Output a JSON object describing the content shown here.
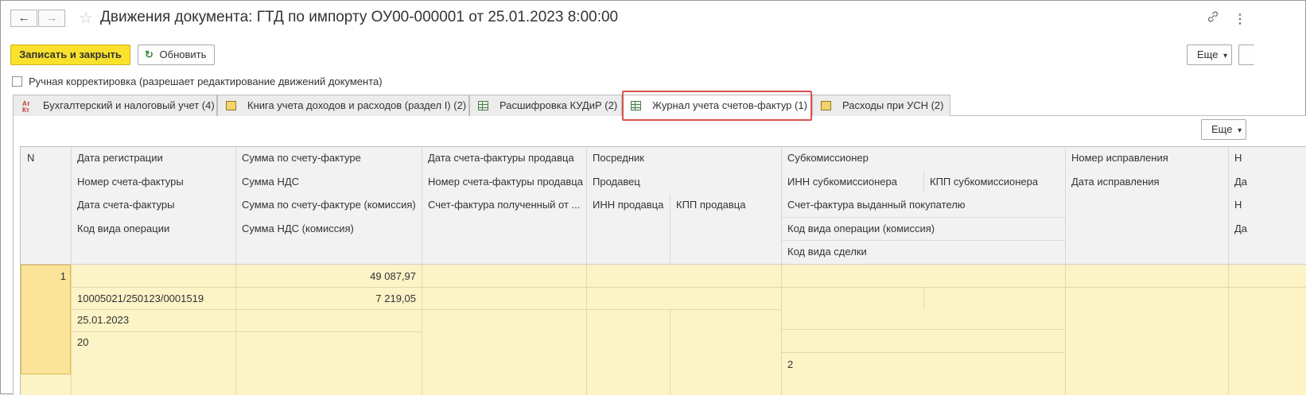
{
  "window": {
    "title": "Движения документа: ГТД по импорту ОУ00-000001 от 25.01.2023 8:00:00",
    "back_icon": "←",
    "forward_icon": "→",
    "favorite_icon": "☆",
    "link_icon": "🔗",
    "more_icon": "⋮"
  },
  "toolbar": {
    "save_close_label": "Записать и закрыть",
    "refresh_label": "Обновить",
    "refresh_icon": "↻",
    "more_label": "Еще",
    "dropdown_icon": "▾"
  },
  "manual_edit": {
    "checked": false,
    "label": "Ручная корректировка (разрешает редактирование движений документа)"
  },
  "tabs": [
    {
      "label": "Бухгалтерский и налоговый учет (4)",
      "icon": "atkt-icon",
      "icon_text": "Ат\nКт"
    },
    {
      "label": "Книга учета доходов и расходов (раздел I) (2)",
      "icon": "register-doc-icon"
    },
    {
      "label": "Расшифровка КУДиР (2)",
      "icon": "table-grid-icon"
    },
    {
      "label": "Журнал учета счетов-фактур (1)",
      "icon": "table-grid-icon",
      "active": true
    },
    {
      "label": "Расходы при УСН (2)",
      "icon": "register-doc-icon"
    }
  ],
  "panel": {
    "more_label": "Еще"
  },
  "table": {
    "headers": {
      "n": "N",
      "c1": [
        "Дата регистрации",
        "Номер счета-фактуры",
        "Дата счета-фактуры",
        "Код вида операции"
      ],
      "c2": [
        "Сумма по счету-фактуре",
        "Сумма НДС",
        "Сумма по счету-фактуре (комиссия)",
        "Сумма НДС (комиссия)"
      ],
      "c3": [
        "Дата счета-фактуры продавца",
        "Номер счета-фактуры продавца",
        "Счет-фактура полученный от ..."
      ],
      "c4": [
        "Посредник",
        "Продавец",
        "ИНН продавца",
        "КПП продавца"
      ],
      "c5": [
        "Субкомиссионер",
        "ИНН субкомиссионера",
        "КПП субкомиссионера",
        "Счет-фактура выданный покупателю",
        "Код вида операции (комиссия)",
        "Код вида сделки"
      ],
      "c6": [
        "Номер исправления",
        "Дата исправления"
      ],
      "c7": [
        "Н",
        "Да",
        "Н",
        "Да"
      ]
    },
    "rows": [
      {
        "n": "1",
        "c1": [
          "",
          "10005021/250123/0001519",
          "25.01.2023",
          "20"
        ],
        "c2": [
          "49 087,97",
          "7 219,05",
          "",
          ""
        ],
        "c5_last": "2"
      }
    ]
  }
}
